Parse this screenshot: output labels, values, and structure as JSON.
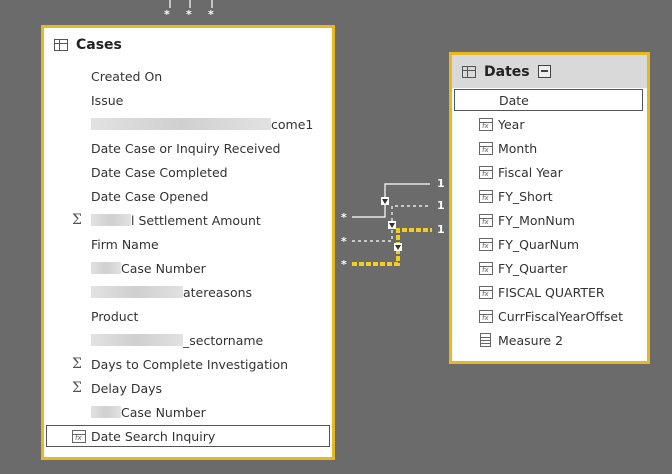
{
  "cases": {
    "title": "Cases",
    "fields": [
      {
        "label": "Created On",
        "icon": "none"
      },
      {
        "label": "Issue",
        "icon": "none"
      },
      {
        "label": "come1",
        "icon": "none",
        "redacted_prefix": true
      },
      {
        "label": "Date Case or Inquiry Received",
        "icon": "none"
      },
      {
        "label": "Date Case Completed",
        "icon": "none"
      },
      {
        "label": "Date Case Opened",
        "icon": "none"
      },
      {
        "label": "l Settlement Amount",
        "icon": "sigma",
        "redacted_prefix": true
      },
      {
        "label": "Firm Name",
        "icon": "none"
      },
      {
        "label": "Case Number",
        "icon": "none",
        "redacted_prefix": true
      },
      {
        "label": "atereasons",
        "icon": "none",
        "redacted_prefix": true
      },
      {
        "label": "Product",
        "icon": "none"
      },
      {
        "label": "_sectorname",
        "icon": "none",
        "redacted_prefix": true
      },
      {
        "label": "Days to Complete Investigation",
        "icon": "sigma"
      },
      {
        "label": "Delay Days",
        "icon": "sigma"
      },
      {
        "label": "Case Number",
        "icon": "none",
        "redacted_prefix": true
      },
      {
        "label": "Date Search Inquiry",
        "icon": "calc",
        "selected": true
      }
    ]
  },
  "dates": {
    "title": "Dates",
    "fields": [
      {
        "label": "Date",
        "icon": "none",
        "selected": true
      },
      {
        "label": "Year",
        "icon": "calc"
      },
      {
        "label": "Month",
        "icon": "calc"
      },
      {
        "label": "Fiscal Year",
        "icon": "calc"
      },
      {
        "label": "FY_Short",
        "icon": "calc"
      },
      {
        "label": "FY_MonNum",
        "icon": "calc"
      },
      {
        "label": "FY_QuarNum",
        "icon": "calc"
      },
      {
        "label": "FY_Quarter",
        "icon": "calc"
      },
      {
        "label": "FISCAL QUARTER",
        "icon": "calc"
      },
      {
        "label": "CurrFiscalYearOffset",
        "icon": "calc"
      },
      {
        "label": "Measure 2",
        "icon": "measure"
      }
    ]
  },
  "relationships": {
    "many_label": "*",
    "one_label": "1",
    "active_color": "#f2cf1f",
    "line_color": "#ffffff"
  },
  "colors": {
    "canvas": "#6b6b6b",
    "card_border": "#e6b822",
    "dates_header": "#d9d9d9"
  }
}
